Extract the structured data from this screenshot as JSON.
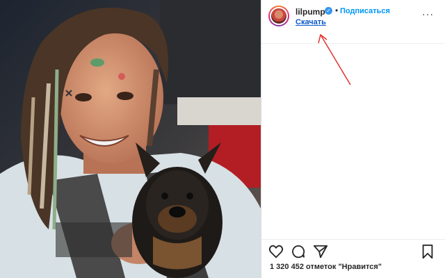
{
  "post": {
    "username": "lilpump",
    "separator": "•",
    "follow_label": "Подписаться",
    "download_label": "Скачать",
    "more_label": "···",
    "likes_text": "1 320 452 отметок \"Нравится\""
  },
  "icons": {
    "verified": "verified-badge-icon",
    "like": "heart-icon",
    "comment": "comment-icon",
    "share": "send-icon",
    "save": "bookmark-icon"
  },
  "colors": {
    "accent": "#0095f6",
    "link": "#0a58ca",
    "annotation_arrow": "#e0322b"
  }
}
